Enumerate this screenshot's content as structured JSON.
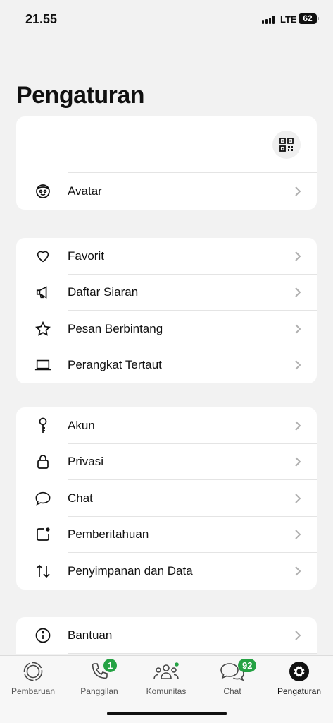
{
  "status": {
    "time": "21.55",
    "network": "LTE",
    "battery": "62"
  },
  "title": "Pengaturan",
  "profile_card": {
    "qr_icon": "qr-code-icon",
    "rows": [
      {
        "label": "Avatar",
        "icon": "avatar-icon"
      }
    ]
  },
  "group1": [
    {
      "label": "Favorit",
      "icon": "heart-icon"
    },
    {
      "label": "Daftar Siaran",
      "icon": "megaphone-icon"
    },
    {
      "label": "Pesan Berbintang",
      "icon": "star-icon"
    },
    {
      "label": "Perangkat Tertaut",
      "icon": "laptop-icon"
    }
  ],
  "group2": [
    {
      "label": "Akun",
      "icon": "key-icon"
    },
    {
      "label": "Privasi",
      "icon": "lock-icon"
    },
    {
      "label": "Chat",
      "icon": "chat-bubble-icon"
    },
    {
      "label": "Pemberitahuan",
      "icon": "notification-icon"
    },
    {
      "label": "Penyimpanan dan Data",
      "icon": "storage-arrows-icon"
    }
  ],
  "group3": [
    {
      "label": "Bantuan",
      "icon": "info-icon"
    }
  ],
  "tabbar": [
    {
      "label": "Pembaruan",
      "icon": "updates-icon",
      "badge": ""
    },
    {
      "label": "Panggilan",
      "icon": "phone-icon",
      "badge": "1"
    },
    {
      "label": "Komunitas",
      "icon": "communities-icon",
      "badge": ""
    },
    {
      "label": "Chat",
      "icon": "chats-icon",
      "badge": "92"
    },
    {
      "label": "Pengaturan",
      "icon": "settings-icon",
      "badge": "",
      "active": true
    }
  ],
  "colors": {
    "accent": "#25a244",
    "background": "#f2f2f2",
    "card": "#ffffff"
  }
}
